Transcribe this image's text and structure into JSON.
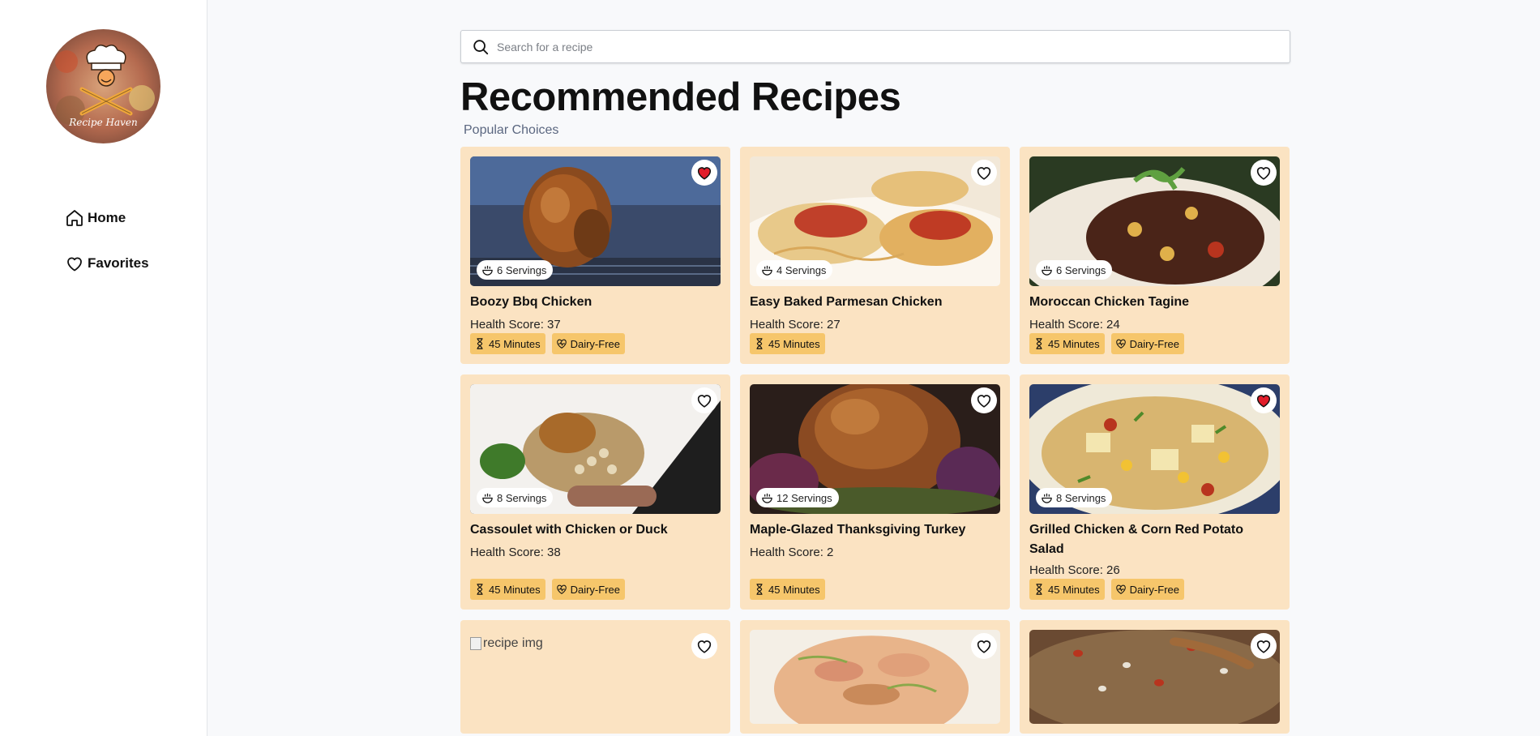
{
  "sidebar": {
    "logo_text": "Recipe Haven",
    "nav": [
      {
        "label": "Home",
        "icon": "home-icon"
      },
      {
        "label": "Favorites",
        "icon": "heart-icon"
      }
    ]
  },
  "search": {
    "placeholder": "Search for a recipe",
    "value": ""
  },
  "header": {
    "title": "Recommended Recipes",
    "subtitle": "Popular Choices"
  },
  "recipes": [
    {
      "name": "Boozy Bbq Chicken",
      "servings": "6 Servings",
      "health": "Health Score: 37",
      "time": "45 Minutes",
      "diet": "Dairy-Free",
      "favorited": true
    },
    {
      "name": "Easy Baked Parmesan Chicken",
      "servings": "4 Servings",
      "health": "Health Score: 27",
      "time": "45 Minutes",
      "diet": "",
      "favorited": false
    },
    {
      "name": "Moroccan Chicken Tagine",
      "servings": "6 Servings",
      "health": "Health Score: 24",
      "time": "45 Minutes",
      "diet": "Dairy-Free",
      "favorited": false
    },
    {
      "name": "Cassoulet with Chicken or Duck",
      "servings": "8 Servings",
      "health": "Health Score: 38",
      "time": "45 Minutes",
      "diet": "Dairy-Free",
      "favorited": false
    },
    {
      "name": "Maple-Glazed Thanksgiving Turkey",
      "servings": "12 Servings",
      "health": "Health Score: 2",
      "time": "45 Minutes",
      "diet": "",
      "favorited": false
    },
    {
      "name": "Grilled Chicken & Corn Red Potato Salad",
      "servings": "8 Servings",
      "health": "Health Score: 26",
      "time": "45 Minutes",
      "diet": "Dairy-Free",
      "favorited": true
    },
    {
      "alt": "recipe img",
      "favorited": false
    },
    {
      "favorited": false
    },
    {
      "favorited": false
    }
  ],
  "colors": {
    "card_bg": "#fbe3c2",
    "tag_bg": "#f6c66b",
    "favorite_active": "#e11d2a",
    "subtitle": "#5b6780"
  }
}
